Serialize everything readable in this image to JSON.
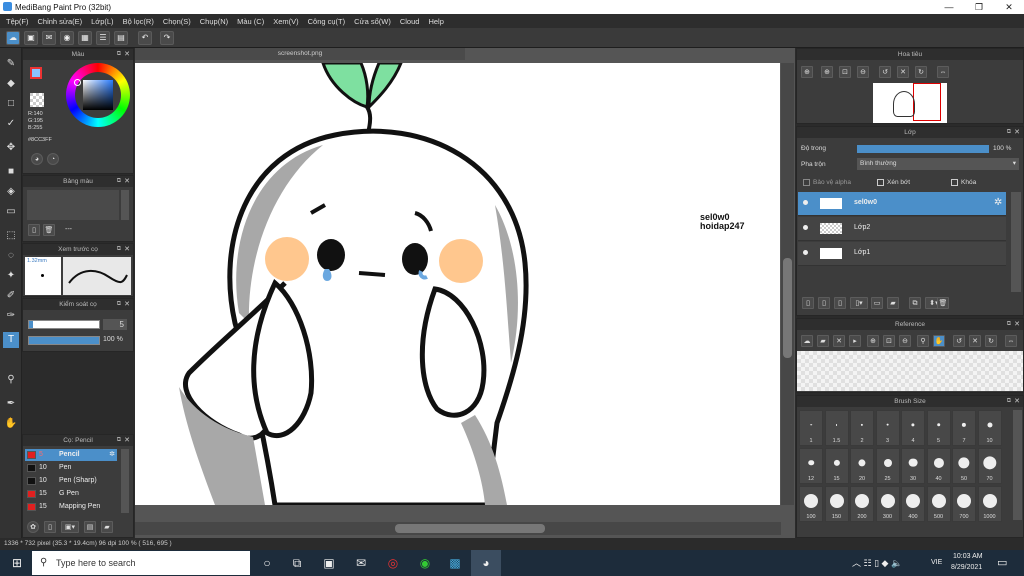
{
  "window": {
    "title": "MediBang Paint Pro (32bit)"
  },
  "menu": [
    "Tệp(F)",
    "Chỉnh sửa(E)",
    "Lớp(L)",
    "Bộ lọc(R)",
    "Chọn(S)",
    "Chụp(N)",
    "Màu (C)",
    "Xem(V)",
    "Công cụ(T)",
    "Cửa sổ(W)",
    "Cloud",
    "Help"
  ],
  "color_panel": {
    "title": "Màu",
    "r": "R:140",
    "g": "G:195",
    "b": "B:255",
    "hex": "#8CC3FF"
  },
  "palette_panel": {
    "title": "Bảng màu",
    "add": "---"
  },
  "preview_panel": {
    "title": "Xem trước cọ",
    "size": "1.32mm"
  },
  "brush_control": {
    "title": "Kiểm soát cọ",
    "size": "5",
    "opacity": "100 %"
  },
  "brush_list": {
    "title": "Cọ: Pencil",
    "items": [
      {
        "size": "5",
        "name": "Pencil",
        "color": "#e02020",
        "selected": true
      },
      {
        "size": "10",
        "name": "Pen",
        "color": "#111111",
        "selected": false
      },
      {
        "size": "10",
        "name": "Pen (Sharp)",
        "color": "#111111",
        "selected": false
      },
      {
        "size": "15",
        "name": "G Pen",
        "color": "#e02020",
        "selected": false
      },
      {
        "size": "15",
        "name": "Mapping Pen",
        "color": "#e02020",
        "selected": false
      }
    ]
  },
  "document": {
    "tab": "screenshot.png",
    "watermark_line1": "sel0w0",
    "watermark_line2": "hoidap247"
  },
  "navigator": {
    "title": "Hoa tiêu"
  },
  "layer_panel": {
    "title": "Lớp",
    "opacity_label": "Độ trong",
    "opacity_value": "100 %",
    "blend_label": "Pha trộn",
    "blend_value": "Bình thường",
    "protect_alpha": "Bảo vệ alpha",
    "clipping": "Xén bớt",
    "lock": "Khóa",
    "layers": [
      {
        "name": "sel0w0",
        "selected": true
      },
      {
        "name": "Lớp2",
        "selected": false
      },
      {
        "name": "Lớp1",
        "selected": false
      }
    ]
  },
  "reference_panel": {
    "title": "Reference"
  },
  "brush_size_panel": {
    "title": "Brush Size",
    "rows": [
      [
        "1",
        "1.5",
        "2",
        "3",
        "4",
        "5",
        "7",
        "10"
      ],
      [
        "12",
        "15",
        "20",
        "25",
        "30",
        "40",
        "50",
        "70"
      ],
      [
        "100",
        "150",
        "200",
        "300",
        "400",
        "500",
        "700",
        "1000"
      ]
    ]
  },
  "status": {
    "text": "1336 * 732 pixel  (35.3 * 19.4cm)  96 dpi  100 %  ( 516, 695 )"
  },
  "taskbar": {
    "search_placeholder": "Type here to search",
    "time": "10:03 AM",
    "date": "8/29/2021",
    "lang": "VIE"
  },
  "colors": {
    "accent": "#4b8fc9",
    "selected_color": "#8CC3FF"
  }
}
